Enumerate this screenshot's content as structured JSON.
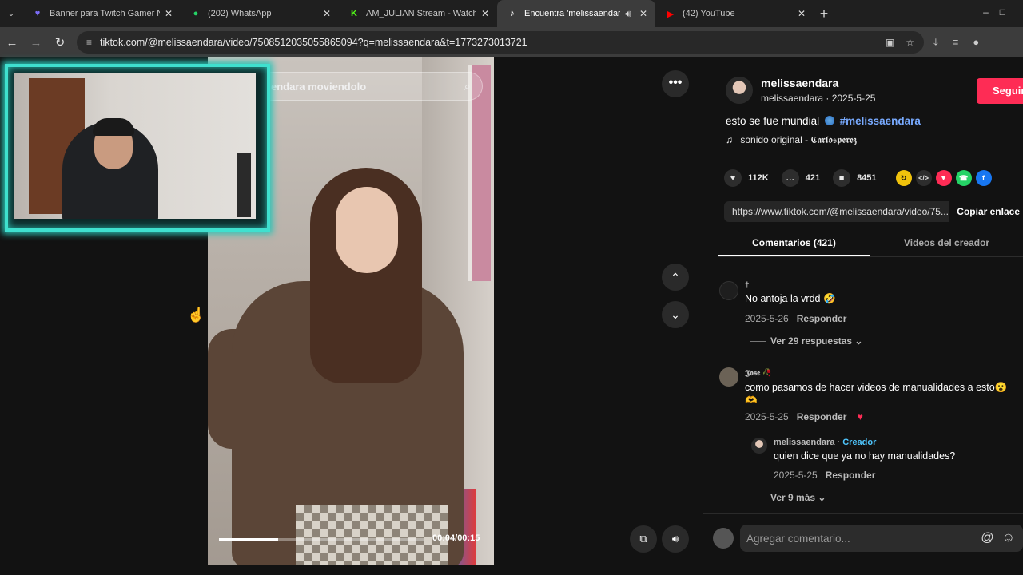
{
  "browser": {
    "tabs": [
      {
        "title": "Banner para Twitch Gamer Neó",
        "icon": "heart-shield-icon",
        "color": "#7b6cf6"
      },
      {
        "title": "(202) WhatsApp",
        "icon": "whatsapp-icon",
        "color": "#25d366"
      },
      {
        "title": "AM_JULIAN Stream - Watch Liv",
        "icon": "kick-icon",
        "color": "#53fc18"
      },
      {
        "title": "Encuentra 'melissaendara' e",
        "icon": "tiktok-icon",
        "color": "#ffffff",
        "active": true
      },
      {
        "title": "(42) YouTube",
        "icon": "youtube-icon",
        "color": "#ff0000"
      }
    ],
    "url": "tiktok.com/@melissaendara/video/7508512035055865094?q=melissaendara&t=1773273013721"
  },
  "video": {
    "search_text": "endara moviendolo",
    "time": "00:04/00:15",
    "progress": 0.29
  },
  "author": {
    "name": "melissaendara",
    "meta": "melissaendara · 2025-5-25",
    "follow_label": "Seguir"
  },
  "post": {
    "caption": "esto se fue mundial",
    "hashtag": "#melissaendara",
    "music": "sonido original - 𝕮𝖆𝖗𝖑𝖔𝖘𝖕𝖊𝖗𝖊𝖟"
  },
  "stats": {
    "likes": "112K",
    "comments": "421",
    "saves": "8451"
  },
  "share": {
    "link": "https://www.tiktok.com/@melissaendara/video/75...",
    "copy_label": "Copiar enlace"
  },
  "panel_tabs": [
    "Comentarios (421)",
    "Videos del creador"
  ],
  "comments": [
    {
      "user": "†",
      "text": "No antoja la vrdd 🤣",
      "date": "2025-5-26",
      "reply": "Responder",
      "more": "Ver 29 respuestas"
    },
    {
      "user": "𝕵𝖔𝖘𝖊 🥀",
      "text": "como pasamos de hacer videos de manualidades a esto😮 🫶",
      "date": "2025-5-25",
      "reply": "Responder"
    },
    {
      "user": "melissaendara",
      "badge": "Creador",
      "text": "quien dice que ya no hay manualidades?",
      "date": "2025-5-25",
      "reply": "Responder",
      "more": "Ver 9 más"
    }
  ],
  "composer": {
    "placeholder": "Agregar comentario..."
  }
}
